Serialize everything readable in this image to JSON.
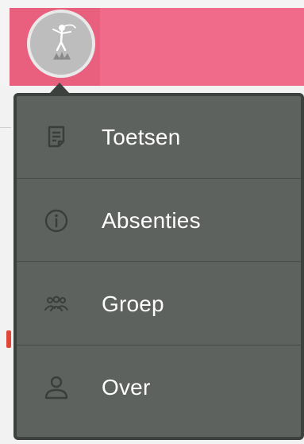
{
  "header": {
    "avatar_icon": "dancer-figure-icon",
    "accent_color": "#f06b8a"
  },
  "menu": {
    "background_color": "#5d625e",
    "items": [
      {
        "label": "Toetsen",
        "icon": "document-icon"
      },
      {
        "label": "Absenties",
        "icon": "info-icon"
      },
      {
        "label": "Groep",
        "icon": "group-icon"
      },
      {
        "label": "Over",
        "icon": "person-icon"
      }
    ]
  }
}
